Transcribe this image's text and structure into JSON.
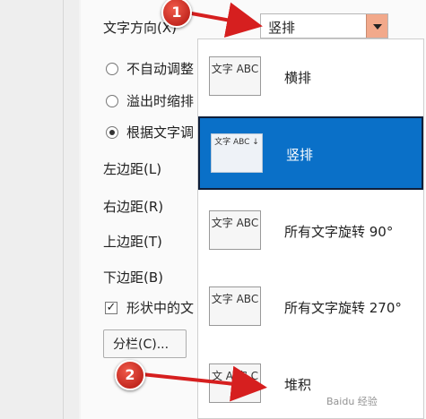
{
  "dialog": {
    "text_direction_label": "文字方向(X)",
    "text_direction_value": "竖排",
    "radio_no_autofit": "不自动调整",
    "radio_shrink_overflow": "溢出时缩排",
    "radio_resize_shape": "根据文字调",
    "left_margin": "左边距(L)",
    "right_margin": "右边距(R)",
    "top_margin": "上边距(T)",
    "bottom_margin": "下边距(B)",
    "wrap_text_checkbox": "形状中的文",
    "columns_button": "分栏(C)..."
  },
  "dropdown": {
    "options": [
      {
        "label": "横排",
        "thumb": "文字 ABC",
        "selected": false
      },
      {
        "label": "竖排",
        "thumb": "文字 ABC ↓",
        "selected": true
      },
      {
        "label": "所有文字旋转 90°",
        "thumb": "文字 ABC",
        "selected": false
      },
      {
        "label": "所有文字旋转 270°",
        "thumb": "文字 ABC",
        "selected": false
      },
      {
        "label": "堆积",
        "thumb": "文 A 字 C",
        "selected": false
      }
    ]
  },
  "badges": {
    "one": "1",
    "two": "2"
  },
  "watermark": "Baidu 经验"
}
